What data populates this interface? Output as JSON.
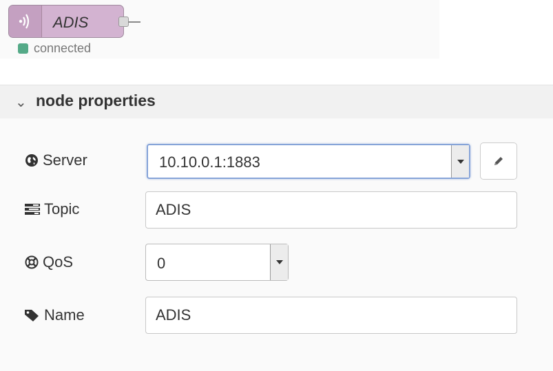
{
  "node": {
    "label": "ADIS",
    "icon": "radio-waves-icon",
    "status_text": "connected",
    "status_color": "#55aa88"
  },
  "section": {
    "title": "node properties",
    "chevron": "⌄"
  },
  "fields": {
    "server": {
      "label": "Server",
      "icon": "globe-icon",
      "value": "10.10.0.1:1883"
    },
    "topic": {
      "label": "Topic",
      "icon": "tasks-icon",
      "value": "ADIS"
    },
    "qos": {
      "label": "QoS",
      "icon": "life-ring-icon",
      "value": "0"
    },
    "name": {
      "label": "Name",
      "icon": "tag-icon",
      "value": "ADIS"
    }
  },
  "edit_button": {
    "icon": "pencil-icon"
  }
}
